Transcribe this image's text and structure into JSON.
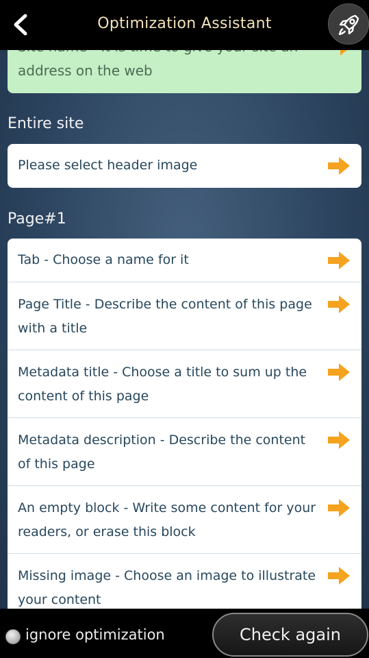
{
  "header": {
    "title": "Optimization Assistant",
    "back_icon": "chevron-left-icon",
    "rocket_icon": "rocket-icon"
  },
  "top_card": {
    "text": "Site name - It is time to give your site an address on the web"
  },
  "sections": [
    {
      "label": "Entire site",
      "items": [
        {
          "text": "Please select header image"
        }
      ]
    },
    {
      "label": "Page#1",
      "items": [
        {
          "text": "Tab - Choose a name for it"
        },
        {
          "text": "Page Title - Describe the content of this page with a title"
        },
        {
          "text": "Metadata title - Choose a title to sum up the content of this page"
        },
        {
          "text": "Metadata description - Describe the content of this page"
        },
        {
          "text": "An empty block - Write some content for your readers, or erase this block"
        },
        {
          "text": "Missing image - Choose an image to illustrate your content"
        }
      ]
    }
  ],
  "footer": {
    "ignore_label": "ignore optimization",
    "check_button": "Check again"
  },
  "colors": {
    "arrow": "#f5a31f",
    "success_card": "#c5efc4",
    "title": "#f3e2b8"
  }
}
